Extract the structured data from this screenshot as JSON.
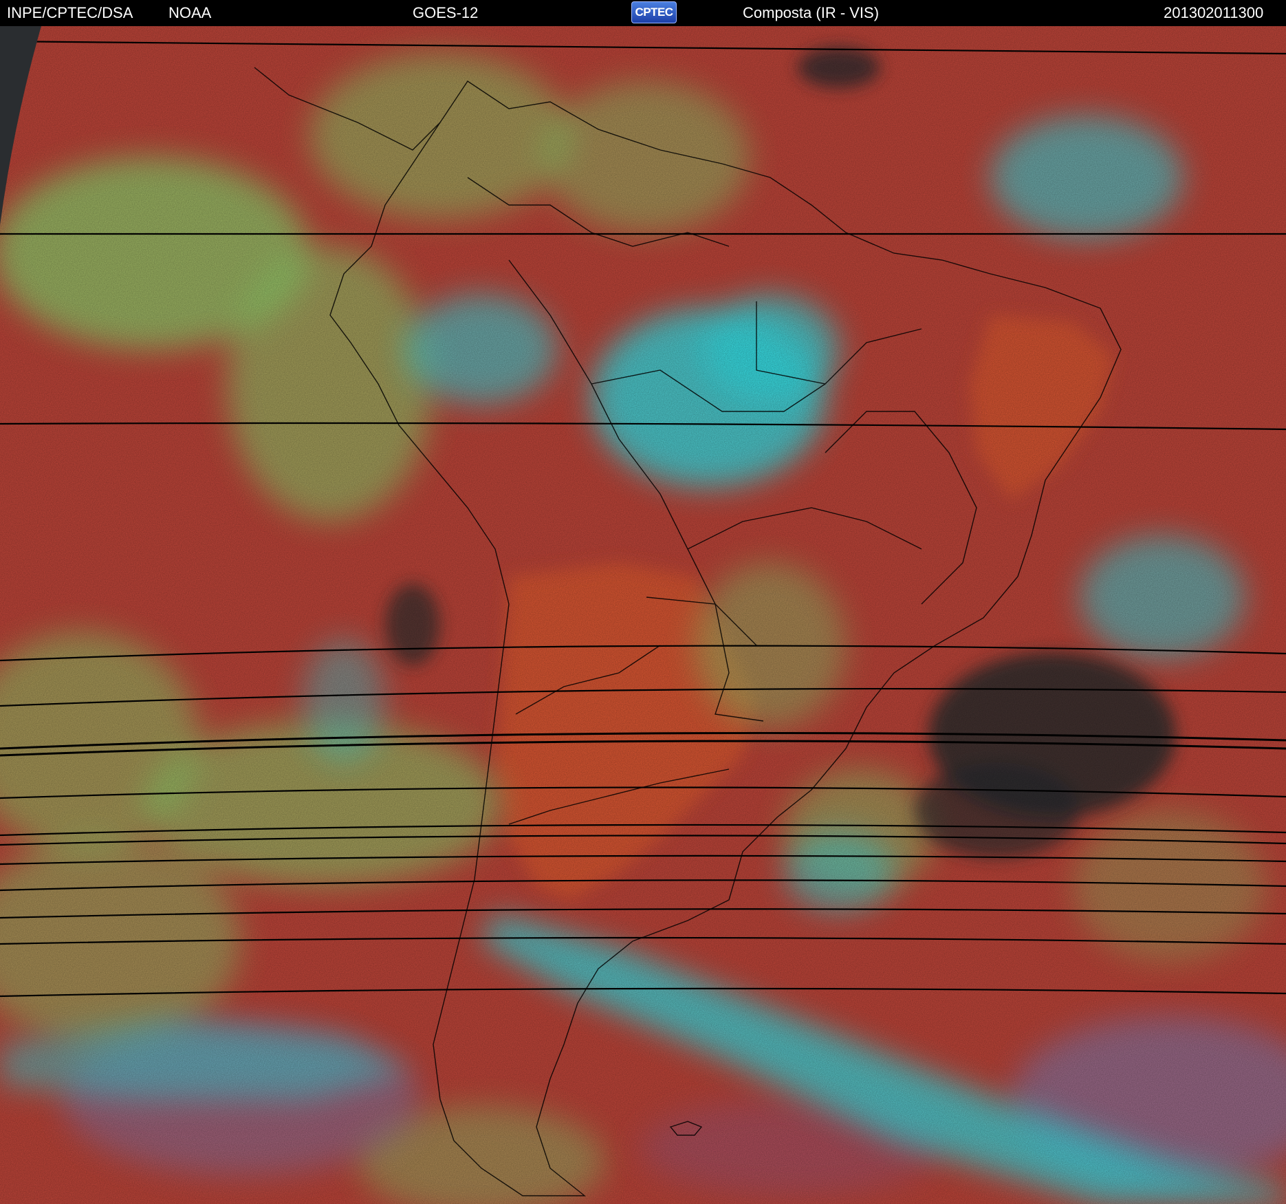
{
  "header": {
    "institution": "INPE/CPTEC/DSA",
    "agency": "NOAA",
    "satellite": "GOES-12",
    "logo_text": "CPTEC",
    "product": "Composta (IR - VIS)",
    "timestamp": "201302011300"
  },
  "colors": {
    "background": "#000000",
    "clear_land_sea": "#c0463a",
    "continent_warm": "#e05a30",
    "low_cloud": "#8fd870",
    "high_cloud": "#30e8f0",
    "mid_cloud": "#7a86c8",
    "space": "#2a2d30",
    "borders": "#000000"
  }
}
